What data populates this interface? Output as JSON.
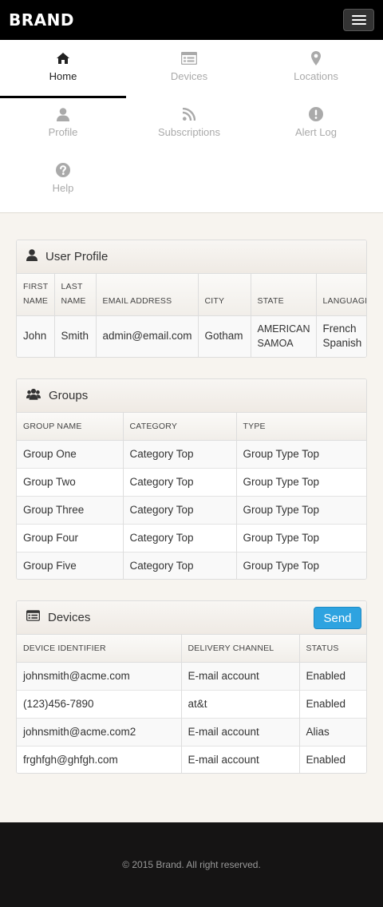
{
  "header": {
    "brand": "BRAND"
  },
  "nav": [
    {
      "label": "Home",
      "icon": "home-icon"
    },
    {
      "label": "Devices",
      "icon": "devices-icon"
    },
    {
      "label": "Locations",
      "icon": "location-icon"
    },
    {
      "label": "Profile",
      "icon": "user-icon"
    },
    {
      "label": "Subscriptions",
      "icon": "rss-icon"
    },
    {
      "label": "Alert Log",
      "icon": "alert-icon"
    },
    {
      "label": "Help",
      "icon": "help-icon"
    }
  ],
  "user_profile": {
    "title": "User Profile",
    "columns": [
      "FIRST NAME",
      "LAST NAME",
      "EMAIL ADDRESS",
      "CITY",
      "STATE",
      "LANGUAGES"
    ],
    "row": [
      "John",
      "Smith",
      "admin@email.com",
      "Gotham",
      "AMERICAN SAMOA",
      "French Spanish"
    ]
  },
  "groups": {
    "title": "Groups",
    "columns": [
      "GROUP NAME",
      "CATEGORY",
      "TYPE"
    ],
    "rows": [
      [
        "Group One",
        "Category Top",
        "Group Type Top"
      ],
      [
        "Group Two",
        "Category Top",
        "Group Type Top"
      ],
      [
        "Group Three",
        "Category Top",
        "Group Type Top"
      ],
      [
        "Group Four",
        "Category Top",
        "Group Type Top"
      ],
      [
        "Group Five",
        "Category Top",
        "Group Type Top"
      ]
    ]
  },
  "devices": {
    "title": "Devices",
    "send_label": "Send",
    "columns": [
      "DEVICE IDENTIFIER",
      "DELIVERY CHANNEL",
      "STATUS"
    ],
    "rows": [
      [
        "johnsmith@acme.com",
        "E-mail account",
        "Enabled"
      ],
      [
        "(123)456-7890",
        "at&t",
        "Enabled"
      ],
      [
        "johnsmith@acme.com2",
        "E-mail account",
        "Alias"
      ],
      [
        "frghfgh@ghfgh.com",
        "E-mail account",
        "Enabled"
      ]
    ]
  },
  "footer": {
    "copyright": "© 2015 Brand. All right reserved."
  },
  "colors": {
    "accent": "#2ea3e0",
    "topbar": "#000000",
    "footer": "#151414",
    "page_bg": "#f7f4ef"
  }
}
